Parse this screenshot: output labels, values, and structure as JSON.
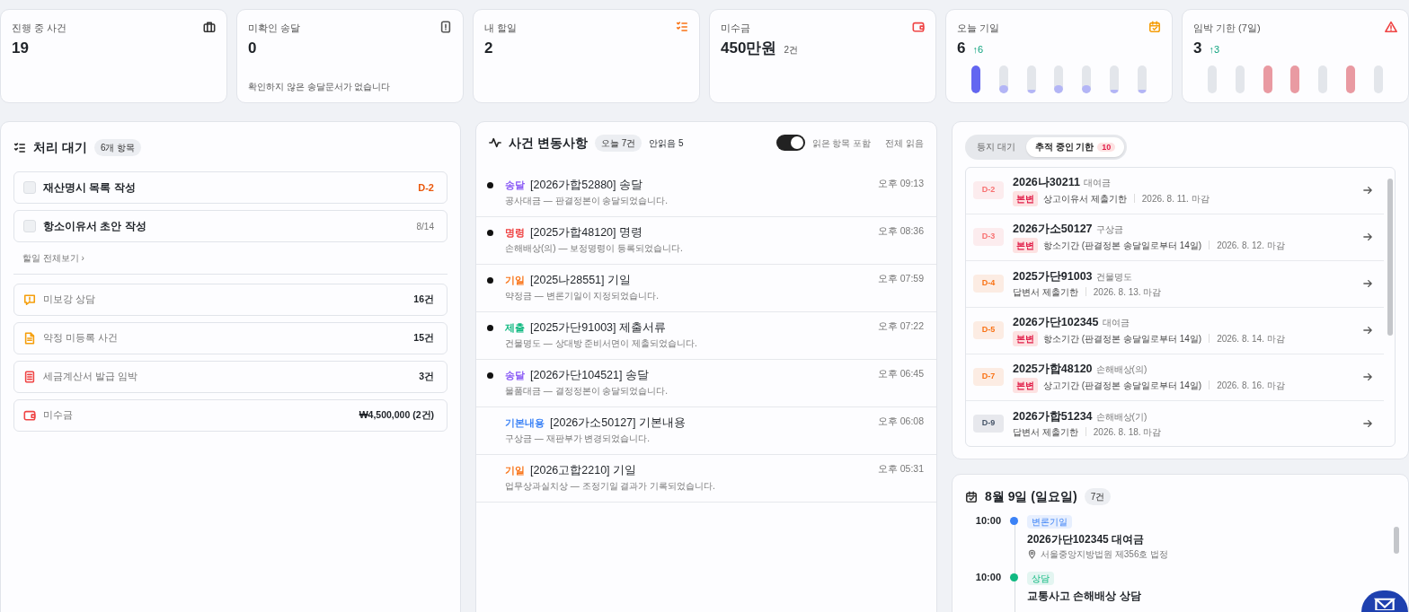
{
  "stats": [
    {
      "label": "진행 중 사건",
      "value": "19",
      "kind": "briefcase"
    },
    {
      "label": "미확인 송달",
      "value": "0",
      "kind": "alert-doc",
      "note": "확인하지 않은 송달문서가 없습니다"
    },
    {
      "label": "내 할일",
      "value": "2",
      "kind": "checklist"
    },
    {
      "label": "미수금",
      "value": "450만원",
      "suffix": "2건",
      "kind": "wallet"
    },
    {
      "label": "오늘 기일",
      "value": "6",
      "delta": "↑6",
      "kind": "calendar",
      "bars": [
        {
          "level": 1,
          "color": "#6366f1"
        },
        {
          "level": 0.3,
          "color": "#b3b5f6"
        },
        {
          "level": 0.12,
          "color": "#b3b5f6"
        },
        {
          "level": 0.3,
          "color": "#b3b5f6"
        },
        {
          "level": 0.3,
          "color": "#b3b5f6"
        },
        {
          "level": 0.12,
          "color": "#b3b5f6"
        },
        {
          "level": 0.12,
          "color": "#b3b5f6"
        }
      ]
    },
    {
      "label": "임박 기한 (7일)",
      "value": "3",
      "delta": "↑3",
      "kind": "warning",
      "bars": [
        {
          "on": false
        },
        {
          "on": false
        },
        {
          "on": true,
          "color": "#e99aa2"
        },
        {
          "on": true,
          "color": "#e99aa2"
        },
        {
          "on": false
        },
        {
          "on": true,
          "color": "#e99aa2"
        },
        {
          "on": false
        }
      ]
    }
  ],
  "pending": {
    "title": "처리 대기",
    "count": "6개 항목",
    "todos": [
      {
        "title": "재산명시 목록 작성",
        "due": "D-2",
        "urgent": true,
        "checked": false
      },
      {
        "title": "항소이유서 초안 작성",
        "due": "8/14",
        "urgent": false,
        "checked": false
      }
    ],
    "view_all": "할일 전체보기 ›",
    "summary": [
      {
        "kind": "consult",
        "label": "미보강 상담",
        "value": "16건",
        "color": "#f59e0b"
      },
      {
        "kind": "document",
        "label": "약정 미등록 사건",
        "value": "15건",
        "color": "#f59e0b"
      },
      {
        "kind": "invoice",
        "label": "세금계산서 발급 임박",
        "value": "3건",
        "color": "#ef4444"
      },
      {
        "kind": "wallet",
        "label": "미수금",
        "value": "₩4,500,000 (2건)",
        "color": "#ef4444"
      }
    ]
  },
  "feed": {
    "title": "사건 변동사항",
    "today": "오늘 7건",
    "unread": "안읽음 5",
    "include_read": {
      "label": "읽은 항목 포함",
      "on": true
    },
    "mark_all": "전체 읽음",
    "items": [
      {
        "tag": "송달",
        "color": "#8b5cf6",
        "title": "[2026가합52880] 송달",
        "desc": "공사대금 — 판결정본이 송달되었습니다.",
        "time": "오후 09:13",
        "unread": true
      },
      {
        "tag": "명령",
        "color": "#ef4444",
        "title": "[2025가합48120] 명령",
        "desc": "손해배상(의) — 보정명령이 등록되었습니다.",
        "time": "오후 08:36",
        "unread": true
      },
      {
        "tag": "기일",
        "color": "#f97316",
        "title": "[2025나28551] 기일",
        "desc": "약정금 — 변론기일이 지정되었습니다.",
        "time": "오후 07:59",
        "unread": true
      },
      {
        "tag": "제출",
        "color": "#10b981",
        "title": "[2025가단91003] 제출서류",
        "desc": "건물명도 — 상대방 준비서면이 제출되었습니다.",
        "time": "오후 07:22",
        "unread": true
      },
      {
        "tag": "송달",
        "color": "#8b5cf6",
        "title": "[2026가단104521] 송달",
        "desc": "물품대금 — 결정정본이 송달되었습니다.",
        "time": "오후 06:45",
        "unread": true
      },
      {
        "tag": "기본내용",
        "color": "#3b82f6",
        "title": "[2026가소50127] 기본내용",
        "desc": "구상금 — 재판부가 변경되었습니다.",
        "time": "오후 06:08",
        "unread": false
      },
      {
        "tag": "기일",
        "color": "#f97316",
        "title": "[2026고합2210] 기일",
        "desc": "업무상과실치상 — 조정기일 결과가 기록되었습니다.",
        "time": "오후 05:31",
        "unread": false
      }
    ]
  },
  "deadlines": {
    "tabs": [
      {
        "label": "등지 대기",
        "selected": false
      },
      {
        "label": "추적 중인 기한",
        "count": "10",
        "selected": true
      }
    ],
    "items": [
      {
        "dday": "D-2",
        "color": "#f87171",
        "case": "2026나30211",
        "type": "대여금",
        "tag": "본변",
        "task": "상고이유서 제출기한",
        "date": "2026. 8. 11. 마감"
      },
      {
        "dday": "D-3",
        "color": "#f87171",
        "case": "2026가소50127",
        "type": "구상금",
        "tag": "본변",
        "task": "항소기간 (판결정본 송달일로부터 14일)",
        "date": "2026. 8. 12. 마감"
      },
      {
        "dday": "D-4",
        "color": "#f97316",
        "case": "2025가단91003",
        "type": "건물명도",
        "task": "답변서 제출기한",
        "date": "2026. 8. 13. 마감"
      },
      {
        "dday": "D-5",
        "color": "#f97316",
        "case": "2026가단102345",
        "type": "대여금",
        "tag": "본변",
        "task": "항소기간 (판결정본 송달일로부터 14일)",
        "date": "2026. 8. 14. 마감"
      },
      {
        "dday": "D-7",
        "color": "#f97316",
        "case": "2025가합48120",
        "type": "손해배상(의)",
        "tag": "본변",
        "task": "상고기간 (판결정본 송달일로부터 14일)",
        "date": "2026. 8. 16. 마감"
      },
      {
        "dday": "D-9",
        "color": "#475569",
        "case": "2026가합51234",
        "type": "손해배상(기)",
        "task": "답변서 제출기한",
        "date": "2026. 8. 18. 마감"
      }
    ]
  },
  "schedule": {
    "title": "8월 9일 (일요일)",
    "count": "7건",
    "items": [
      {
        "time": "10:00",
        "color": "#3b82f6",
        "tag": "변론기일",
        "title": "2026가단102345 대여금",
        "location": "서울중앙지방법원 제356호 법정"
      },
      {
        "time": "10:00",
        "color": "#10b981",
        "tag": "상담",
        "title": "교통사고 손해배상 상담"
      }
    ]
  }
}
